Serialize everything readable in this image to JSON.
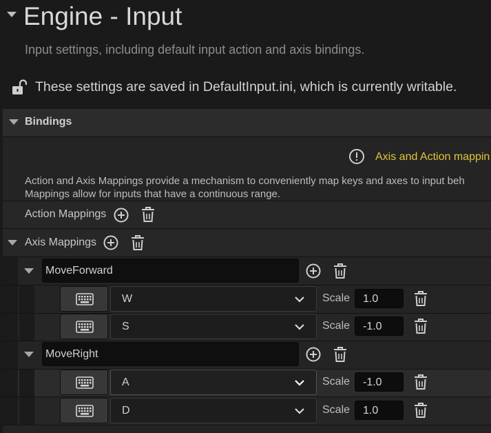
{
  "section": {
    "title": "Engine - Input",
    "description": "Input settings, including default input action and axis bindings.",
    "saved_notice": "These settings are saved in DefaultInput.ini, which is currently writable."
  },
  "bindings": {
    "label": "Bindings",
    "warning_text": "Axis and Action mappin",
    "info_line1": "Action and Axis Mappings provide a mechanism to conveniently map keys and axes to input beh",
    "info_line2": "Mappings allow for inputs that have a continuous range.",
    "action_mappings_label": "Action Mappings",
    "axis_mappings_label": "Axis Mappings",
    "scale_label": "Scale",
    "axis_groups": [
      {
        "name": "MoveForward",
        "keys": [
          {
            "key": "W",
            "scale": "1.0"
          },
          {
            "key": "S",
            "scale": "-1.0"
          }
        ]
      },
      {
        "name": "MoveRight",
        "keys": [
          {
            "key": "A",
            "scale": "-1.0"
          },
          {
            "key": "D",
            "scale": "1.0"
          }
        ]
      }
    ]
  },
  "icons": {
    "expand": "caret-down-icon",
    "lock": "unlocked-padlock-icon",
    "warning": "exclamation-circle-icon",
    "add": "plus-circle-icon",
    "delete": "trash-can-icon",
    "keyboard": "keyboard-icon",
    "dropdown": "chevron-down-icon"
  },
  "colors": {
    "warning": "#e2c53a",
    "background": "#1a1a1a",
    "panel": "#242424"
  }
}
